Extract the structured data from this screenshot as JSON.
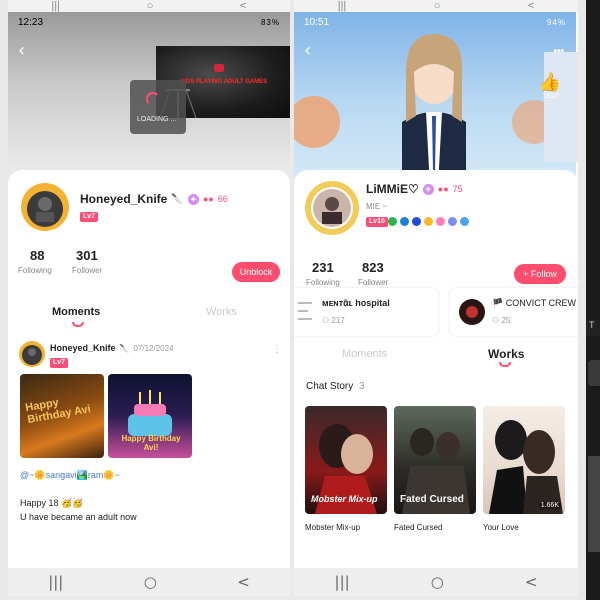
{
  "nav_top": {
    "menu": "|||",
    "home": "○",
    "back": "<"
  },
  "nav_bottom": {
    "menu": "|||",
    "home": "○",
    "back": "<"
  },
  "left": {
    "status_time": "12:23",
    "status_icons": "83%",
    "video_title": "KIDS PLAYING ADULT GAMES",
    "loading": "LOADING ...",
    "username": "Honeyed_Knife",
    "username_suffix": "🔪",
    "badge_count": "66",
    "level": "Lv7",
    "following_count": "88",
    "following_label": "Following",
    "follower_count": "301",
    "follower_label": "Follower",
    "unblock": "Unblock",
    "tab_moments": "Moments",
    "tab_works": "Works",
    "post": {
      "author": "Honeyed_Knife",
      "author_suffix": "🔪",
      "date": "07/12/2024",
      "level": "Lv7",
      "image1_text": "Happy Birthday Avi",
      "image2_text": "Happy Birthday Avi!",
      "mention": "@~🌼sangavi🏞️ram🌼~",
      "line1": "Happy 18 🥳🥳",
      "line2": "U have became an adult now"
    }
  },
  "right": {
    "status_time": "10:51",
    "status_icons": "94%",
    "like_count": "1810",
    "more": "•••",
    "username": "LiMMiE♡",
    "badge_count": "75",
    "subtitle": "MIE ~",
    "level": "Lv10",
    "following_count": "231",
    "following_label": "Following",
    "follower_count": "823",
    "follower_label": "Follower",
    "follow": "+ Follow",
    "communities": [
      {
        "name": "ᴍᴇɴᴛᾶʟ hospital",
        "members": "217"
      },
      {
        "name": "🏴 CONVICT CREW",
        "members": "25"
      }
    ],
    "tab_moments": "Moments",
    "tab_works": "Works",
    "section_title": "Chat Story",
    "section_count": "3",
    "stories": [
      {
        "title": "Mobster Mix-up",
        "cover_text": "Mobster Mix-up",
        "views": ""
      },
      {
        "title": "Fated Cursed",
        "cover_text": "Fated Cursed",
        "views": ""
      },
      {
        "title": "Your Love",
        "cover_text": "",
        "views": "1.66K"
      }
    ]
  },
  "third": {
    "label": "T"
  }
}
